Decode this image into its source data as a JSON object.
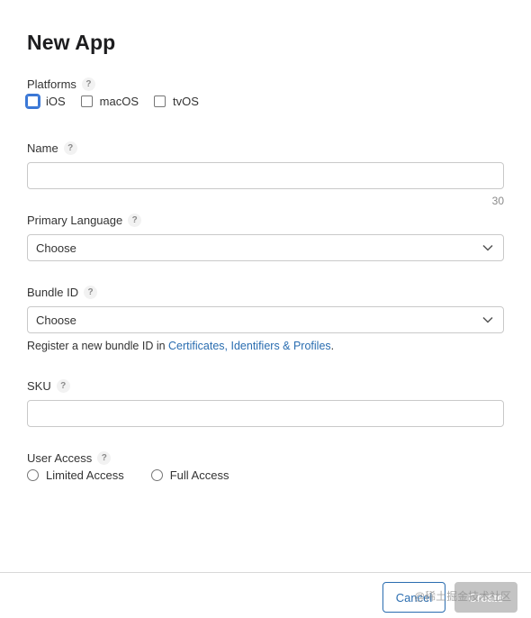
{
  "dialog": {
    "title": "New App"
  },
  "platforms": {
    "label": "Platforms",
    "help": "?",
    "options": [
      {
        "label": "iOS",
        "checked": false,
        "focused": true
      },
      {
        "label": "macOS",
        "checked": false
      },
      {
        "label": "tvOS",
        "checked": false
      }
    ]
  },
  "name": {
    "label": "Name",
    "help": "?",
    "value": "",
    "char_limit": "30"
  },
  "primary_language": {
    "label": "Primary Language",
    "help": "?",
    "selected": "Choose"
  },
  "bundle_id": {
    "label": "Bundle ID",
    "help": "?",
    "selected": "Choose",
    "hint_prefix": "Register a new bundle ID in ",
    "hint_link": "Certificates, Identifiers & Profiles",
    "hint_suffix": "."
  },
  "sku": {
    "label": "SKU",
    "help": "?",
    "value": ""
  },
  "user_access": {
    "label": "User Access",
    "help": "?",
    "options": [
      {
        "label": "Limited Access",
        "selected": false
      },
      {
        "label": "Full Access",
        "selected": false
      }
    ]
  },
  "footer": {
    "cancel_label": "Cancel",
    "create_label": "Create",
    "watermark": "@稀土掘金技术社区"
  },
  "colors": {
    "link": "#2a6db0",
    "focus": "#3b78d6",
    "disabled_button": "#c4c4c4"
  },
  "icons": {
    "help": "question-mark-icon",
    "select": "chevron-down-icon"
  }
}
